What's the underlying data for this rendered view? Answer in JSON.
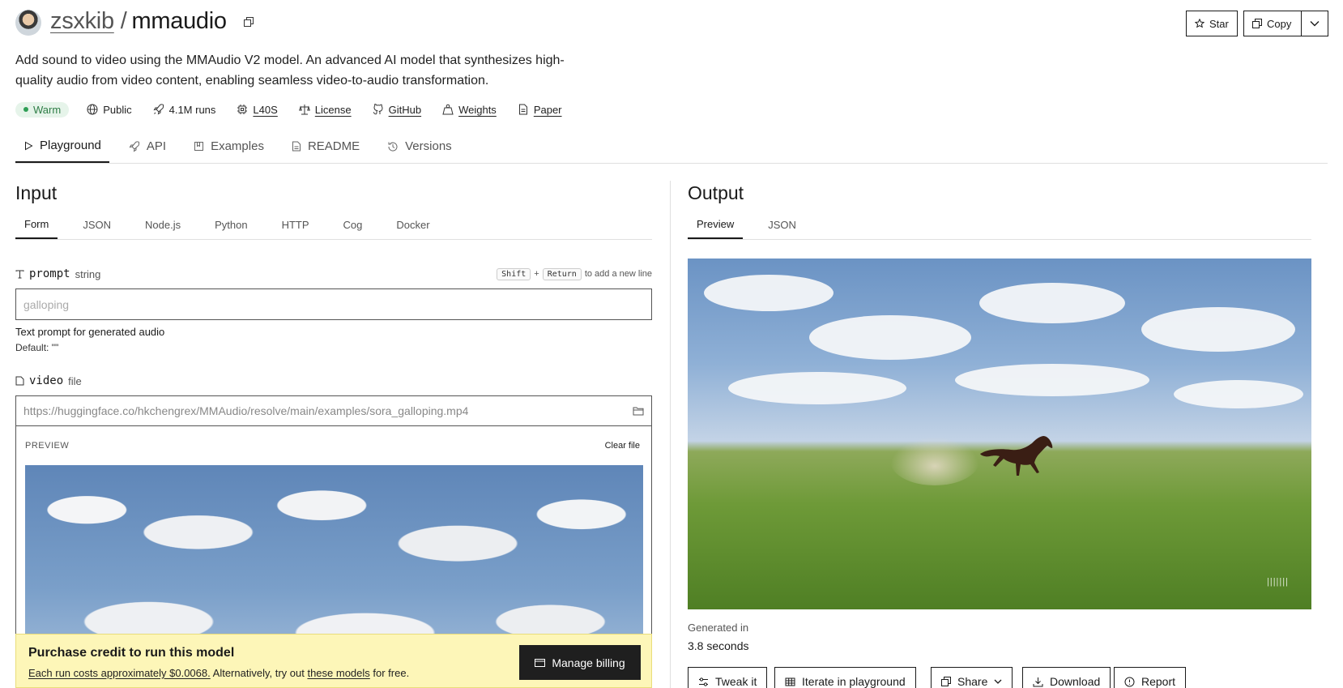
{
  "header": {
    "owner": "zsxkib",
    "model": "mmaudio",
    "star_label": "Star",
    "copy_label": "Copy"
  },
  "description": "Add sound to video using the MMAudio V2 model. An advanced AI model that synthesizes high-quality audio from video content, enabling seamless video-to-audio transformation.",
  "meta": {
    "status": "Warm",
    "visibility": "Public",
    "runs": "4.1M runs",
    "hardware": "L40S",
    "license": "License",
    "github": "GitHub",
    "weights": "Weights",
    "paper": "Paper"
  },
  "main_tabs": [
    "Playground",
    "API",
    "Examples",
    "README",
    "Versions"
  ],
  "input": {
    "title": "Input",
    "tabs": [
      "Form",
      "JSON",
      "Node.js",
      "Python",
      "HTTP",
      "Cog",
      "Docker"
    ],
    "prompt": {
      "name": "prompt",
      "type": "string",
      "hint_key1": "Shift",
      "hint_plus": "+",
      "hint_key2": "Return",
      "hint_text": "to add a new line",
      "placeholder": "galloping",
      "help": "Text prompt for generated audio",
      "default": "Default: \"\""
    },
    "video": {
      "name": "video",
      "type": "file",
      "value": "https://huggingface.co/hkchengrex/MMAudio/resolve/main/examples/sora_galloping.mp4",
      "preview_label": "PREVIEW",
      "clear_label": "Clear file"
    }
  },
  "banner": {
    "title": "Purchase credit to run this model",
    "cost_text": "Each run costs approximately $0.0068.",
    "middle_text": " Alternatively, try out ",
    "models_link": "these models",
    "end_text": " for free.",
    "button": "Manage billing"
  },
  "output": {
    "title": "Output",
    "tabs": [
      "Preview",
      "JSON"
    ],
    "watermark": "|||||||",
    "generated_label": "Generated in",
    "generated_value": "3.8 seconds",
    "actions": [
      "Tweak it",
      "Iterate in playground",
      "Share",
      "Download",
      "Report"
    ]
  },
  "colors": {
    "warm_bg": "#e6f4ea",
    "warm_text": "#2e7d46",
    "banner_bg": "#fdf6b8",
    "billing_btn": "#1f1f1f"
  }
}
